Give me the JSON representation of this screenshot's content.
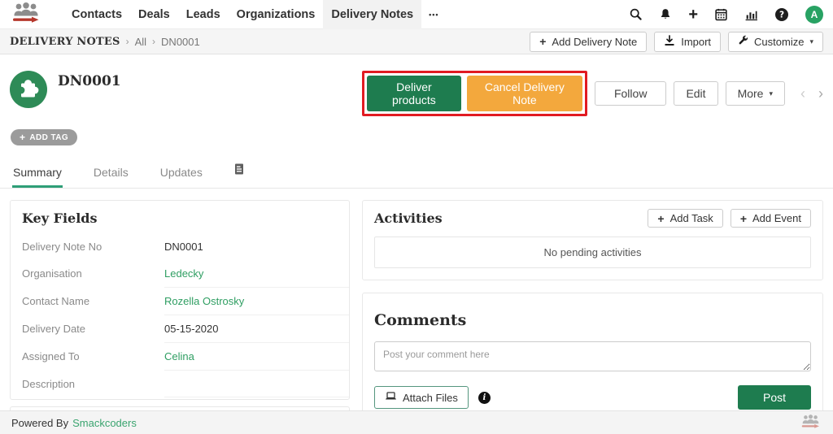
{
  "navbar": {
    "items": [
      "Contacts",
      "Deals",
      "Leads",
      "Organizations",
      "Delivery Notes"
    ],
    "active_item": "Delivery Notes",
    "right_icons": [
      "search-icon",
      "notifications-bell-icon",
      "quick-create-plus-icon",
      "calendar-icon",
      "reports-chart-icon",
      "help-icon"
    ],
    "avatar_initial": "A"
  },
  "breadcrumb": {
    "module": "DELIVERY NOTES",
    "separator": "›",
    "view": "All",
    "record": "DN0001"
  },
  "list_toolbar": {
    "add_button": "Add Delivery Note",
    "import_button": "Import",
    "customize_button": "Customize"
  },
  "record_header": {
    "title": "DN0001",
    "add_tag_label": "ADD TAG"
  },
  "record_actions": {
    "deliver": "Deliver products",
    "cancel": "Cancel Delivery Note",
    "follow": "Follow",
    "edit": "Edit",
    "more": "More"
  },
  "tabs": {
    "items": [
      "Summary",
      "Details",
      "Updates"
    ],
    "active": "Summary"
  },
  "key_fields": {
    "title": "Key Fields",
    "rows": [
      {
        "label": "Delivery Note No",
        "value": "DN0001",
        "type": "text"
      },
      {
        "label": "Organisation",
        "value": "Ledecky",
        "type": "link"
      },
      {
        "label": "Contact Name",
        "value": "Rozella Ostrosky",
        "type": "link"
      },
      {
        "label": "Delivery Date",
        "value": "05-15-2020",
        "type": "text"
      },
      {
        "label": "Assigned To",
        "value": "Celina",
        "type": "link"
      },
      {
        "label": "Description",
        "value": "",
        "type": "text"
      }
    ]
  },
  "activities": {
    "title": "Activities",
    "add_task": "Add Task",
    "add_event": "Add Event",
    "empty_message": "No pending activities"
  },
  "comments": {
    "title": "Comments",
    "placeholder": "Post your comment here",
    "attach_button": "Attach Files",
    "post_button": "Post"
  },
  "footer": {
    "powered_by": "Powered By",
    "brand": "Smackcoders"
  },
  "icons": {
    "plus": "+",
    "caret_down": "▾",
    "chevron_left": "‹",
    "chevron_right": "›",
    "ellipsis": "•••",
    "info": "i"
  },
  "colors": {
    "primary_green": "#1e7c4f",
    "link_green": "#2f9e62",
    "warning_orange": "#f3a83d",
    "highlight_red": "#e11b22",
    "avatar_green": "#28a263",
    "record_icon_green": "#2e8b57",
    "tab_underline_green": "#2e9e77"
  }
}
